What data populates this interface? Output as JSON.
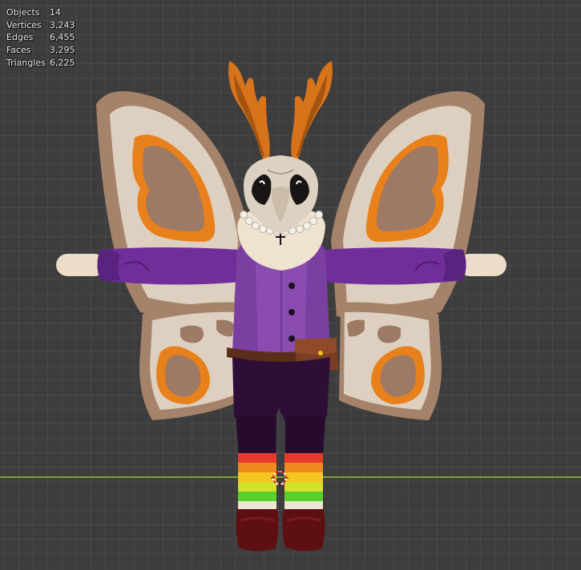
{
  "stats": [
    {
      "label": "Objects",
      "value": "14"
    },
    {
      "label": "Vertices",
      "value": "3,243"
    },
    {
      "label": "Edges",
      "value": "6,455"
    },
    {
      "label": "Faces",
      "value": "3,295"
    },
    {
      "label": "Triangles",
      "value": "6,225"
    }
  ],
  "colors": {
    "viewport_bg": "#3d3d3d",
    "horizon": "#7fa23a",
    "wing_outer": "#a5826a",
    "wing_inner": "#ddd0c0",
    "wing_spot": "#e8801b",
    "shirt": "#8a4cb0",
    "pants": "#2e0e36",
    "antler": "#d7731a"
  }
}
